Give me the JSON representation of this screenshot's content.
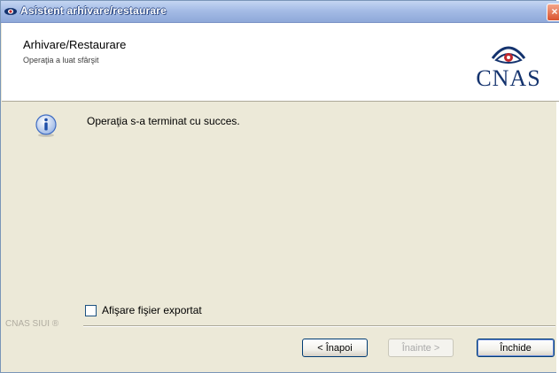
{
  "window": {
    "title": "Asistent arhivare/restaurare",
    "close_glyph": "×"
  },
  "header": {
    "title": "Arhivare/Restaurare",
    "subtitle": "Operaţia a luat sfârşit",
    "logo_text": "CNAS"
  },
  "content": {
    "icon": "info-icon",
    "message": "Operaţia s-a terminat cu succes.",
    "checkbox_label": "Afişare fişier exportat",
    "checkbox_checked": false
  },
  "footer": {
    "group_label": "CNAS SIUI ®",
    "back_label": "< Înapoi",
    "next_label": "Înainte >",
    "close_label": "Închide"
  },
  "colors": {
    "titlebar": "#a5bce6",
    "logo_navy": "#14336e",
    "logo_red": "#c0282d"
  }
}
